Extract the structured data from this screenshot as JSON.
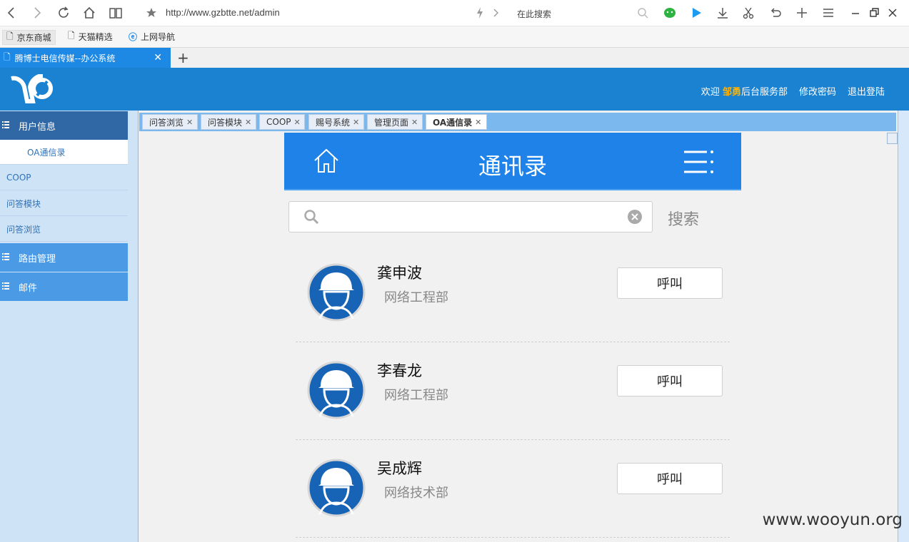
{
  "browser": {
    "url": "http://www.gzbtte.net/admin",
    "search_placeholder": "在此搜索",
    "bookmarks": [
      "京东商城",
      "天猫精选",
      "上网导航"
    ],
    "tab_title": "腾博士电信传媒--办公系统",
    "new_tab": "+"
  },
  "header": {
    "welcome": "欢迎",
    "org": "邹勇",
    "dept": "后台服务部",
    "change_password": "修改密码",
    "logout": "退出登陆"
  },
  "sidebar": {
    "user_info": "用户信息",
    "items": [
      "OA通信录",
      "COOP",
      "问答模块",
      "问答浏览"
    ],
    "route_mgmt": "路由管理",
    "mail": "邮件"
  },
  "inner_tabs": [
    "问答浏览",
    "问答模块",
    "COOP",
    "赐号系统",
    "管理页面",
    "OA通信录"
  ],
  "phonebook": {
    "title": "通讯录",
    "search_label": "搜索",
    "call_label": "呼叫",
    "contacts": [
      {
        "name": "龚申波",
        "dept": "网络工程部"
      },
      {
        "name": "李春龙",
        "dept": "网络工程部"
      },
      {
        "name": "吴成辉",
        "dept": "网络技术部"
      }
    ]
  },
  "watermark": "www.wooyun.org",
  "colors": {
    "header_blue": "#1b82d1",
    "phone_blue": "#1e82e8",
    "sidebar_bg": "#cfe3f7",
    "accent_orange": "#ffb300"
  }
}
